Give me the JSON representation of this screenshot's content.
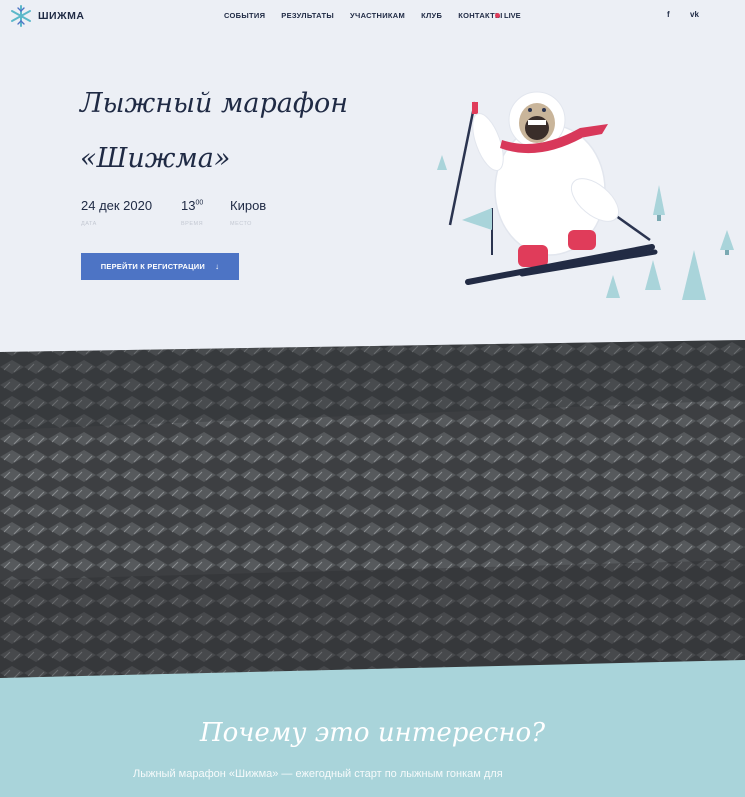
{
  "nav": {
    "logo_text": "ШИЖМА",
    "menu": [
      "СОБЫТИЯ",
      "РЕЗУЛЬТАТЫ",
      "УЧАСТНИКАМ",
      "КЛУБ",
      "КОНТАКТЫ"
    ],
    "live": "LIVE",
    "social": {
      "facebook": "f",
      "vk": "vk"
    }
  },
  "hero": {
    "title_line1": "Лыжный марафон",
    "title_line2": "«Шижма»",
    "date_value": "24 дек 2020",
    "date_label": "ДАТА",
    "time_hours": "13",
    "time_minutes": "00",
    "time_label": "ВРЕМЯ",
    "place_value": "Киров",
    "place_label": "МЕСТО",
    "register_button": "ПЕРЕЙТИ К РЕГИСТРАЦИИ",
    "register_arrow": "↓"
  },
  "section_why": {
    "title": "Почему это интересно?",
    "text": "Лыжный марафон «Шижма» — ежегодный старт по лыжным гонкам для"
  },
  "colors": {
    "accent": "#4d74c5",
    "live_dot": "#e03c5a",
    "dark": "#1f2a44",
    "section_bg": "#a9d4da"
  }
}
